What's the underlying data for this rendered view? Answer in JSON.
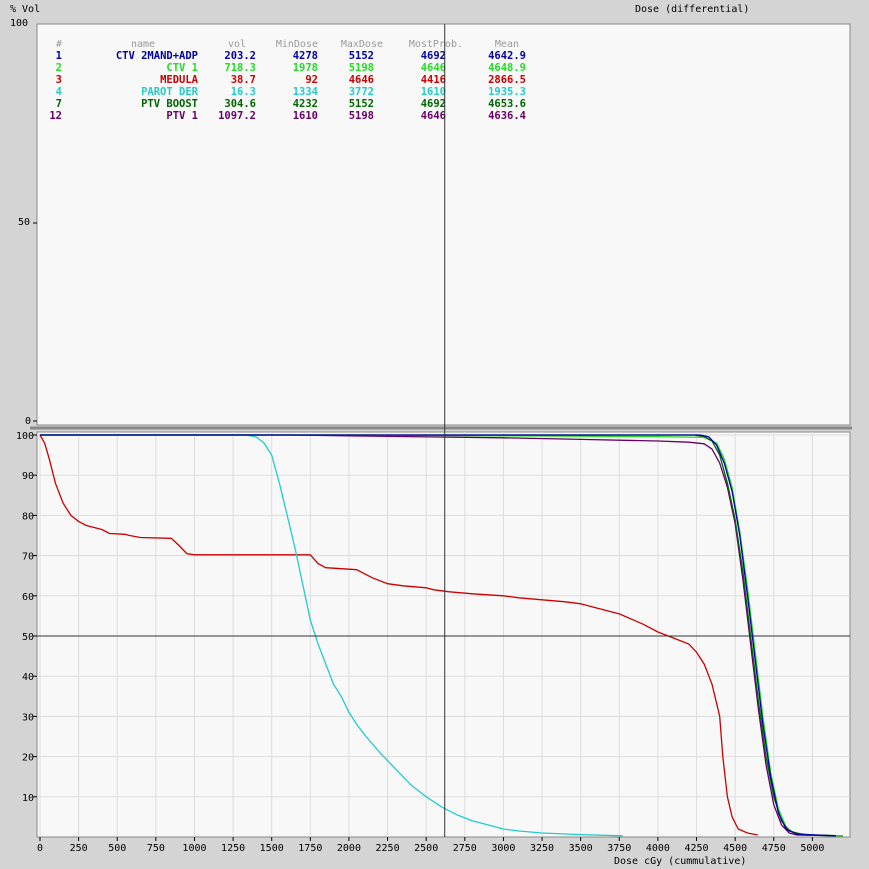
{
  "top_panel": {
    "y_label": "% Vol",
    "title": "Dose (differential)",
    "y_ticks": [
      "100",
      "50",
      "0"
    ]
  },
  "table": {
    "headers": [
      "#",
      "name",
      "vol",
      "MinDose",
      "MaxDose",
      "MostProb.",
      "Mean"
    ],
    "rows": [
      {
        "id": "1",
        "name": "CTV 2MAND+ADP",
        "vol": "203.2",
        "min": "4278",
        "max": "5152",
        "mostprob": "4692",
        "mean": "4642.9",
        "color": "#0000aa"
      },
      {
        "id": "2",
        "name": "CTV 1",
        "vol": "718.3",
        "min": "1978",
        "max": "5198",
        "mostprob": "4646",
        "mean": "4648.9",
        "color": "#22dd22"
      },
      {
        "id": "3",
        "name": "MEDULA",
        "vol": "38.7",
        "min": "92",
        "max": "4646",
        "mostprob": "4416",
        "mean": "2866.5",
        "color": "#cc0000"
      },
      {
        "id": "4",
        "name": "PAROT DER",
        "vol": "16.3",
        "min": "1334",
        "max": "3772",
        "mostprob": "1610",
        "mean": "1935.3",
        "color": "#22cccc"
      },
      {
        "id": "7",
        "name": "PTV BOOST",
        "vol": "304.6",
        "min": "4232",
        "max": "5152",
        "mostprob": "4692",
        "mean": "4653.6",
        "color": "#006600"
      },
      {
        "id": "12",
        "name": "PTV 1",
        "vol": "1097.2",
        "min": "1610",
        "max": "5198",
        "mostprob": "4646",
        "mean": "4636.4",
        "color": "#660066"
      }
    ]
  },
  "chart_data": {
    "type": "line",
    "xlabel": "Dose cGy (cummulative)",
    "ylabel": "% Vol",
    "xlim": [
      0,
      5250
    ],
    "ylim": [
      0,
      100
    ],
    "x_ticks": [
      "0",
      "250",
      "500",
      "750",
      "1000",
      "1250",
      "1500",
      "1750",
      "2000",
      "2250",
      "2500",
      "2750",
      "3000",
      "3250",
      "3500",
      "3750",
      "4000",
      "4250",
      "4500",
      "4750",
      "5000"
    ],
    "y_ticks": [
      "100",
      "90",
      "80",
      "70",
      "60",
      "50",
      "40",
      "30",
      "20",
      "10"
    ],
    "reference_line_y": 50,
    "cursor_x": 2620,
    "grid": true,
    "series": [
      {
        "name": "MEDULA",
        "color": "#cc0000",
        "points": [
          [
            0,
            100
          ],
          [
            30,
            98
          ],
          [
            60,
            94
          ],
          [
            100,
            88
          ],
          [
            150,
            83
          ],
          [
            200,
            80
          ],
          [
            250,
            78.5
          ],
          [
            300,
            77.5
          ],
          [
            350,
            77
          ],
          [
            400,
            76.5
          ],
          [
            450,
            75.5
          ],
          [
            550,
            75.3
          ],
          [
            580,
            75
          ],
          [
            650,
            74.5
          ],
          [
            850,
            74.3
          ],
          [
            900,
            72.5
          ],
          [
            950,
            70.5
          ],
          [
            1000,
            70.2
          ],
          [
            1750,
            70.2
          ],
          [
            1800,
            68
          ],
          [
            1850,
            67
          ],
          [
            2050,
            66.5
          ],
          [
            2100,
            65.5
          ],
          [
            2150,
            64.5
          ],
          [
            2250,
            63
          ],
          [
            2350,
            62.5
          ],
          [
            2500,
            62
          ],
          [
            2550,
            61.5
          ],
          [
            2650,
            61
          ],
          [
            2800,
            60.5
          ],
          [
            3000,
            60
          ],
          [
            3100,
            59.5
          ],
          [
            3250,
            59
          ],
          [
            3400,
            58.5
          ],
          [
            3500,
            58
          ],
          [
            3600,
            57
          ],
          [
            3750,
            55.5
          ],
          [
            3900,
            53
          ],
          [
            4000,
            51
          ],
          [
            4100,
            49.5
          ],
          [
            4200,
            48
          ],
          [
            4250,
            46
          ],
          [
            4300,
            43
          ],
          [
            4350,
            38
          ],
          [
            4400,
            30
          ],
          [
            4420,
            20
          ],
          [
            4450,
            10
          ],
          [
            4480,
            5
          ],
          [
            4520,
            2
          ],
          [
            4580,
            1
          ],
          [
            4646,
            0.5
          ]
        ]
      },
      {
        "name": "PAROT DER",
        "color": "#22cccc",
        "points": [
          [
            0,
            100
          ],
          [
            1334,
            100
          ],
          [
            1400,
            99.5
          ],
          [
            1450,
            98
          ],
          [
            1500,
            95
          ],
          [
            1550,
            88
          ],
          [
            1600,
            80
          ],
          [
            1650,
            72
          ],
          [
            1700,
            63
          ],
          [
            1750,
            54
          ],
          [
            1800,
            48
          ],
          [
            1850,
            43
          ],
          [
            1900,
            38
          ],
          [
            1950,
            35
          ],
          [
            2000,
            31
          ],
          [
            2050,
            28
          ],
          [
            2100,
            25.5
          ],
          [
            2200,
            21
          ],
          [
            2300,
            17
          ],
          [
            2400,
            13
          ],
          [
            2500,
            10
          ],
          [
            2600,
            7.5
          ],
          [
            2700,
            5.5
          ],
          [
            2800,
            4
          ],
          [
            2900,
            3
          ],
          [
            3000,
            2
          ],
          [
            3100,
            1.5
          ],
          [
            3250,
            1
          ],
          [
            3500,
            0.6
          ],
          [
            3772,
            0.3
          ]
        ]
      },
      {
        "name": "PTV 1",
        "color": "#660066",
        "points": [
          [
            0,
            100
          ],
          [
            1610,
            100
          ],
          [
            2000,
            99.8
          ],
          [
            3000,
            99.3
          ],
          [
            3500,
            98.9
          ],
          [
            4000,
            98.5
          ],
          [
            4200,
            98.2
          ],
          [
            4300,
            97.8
          ],
          [
            4350,
            96.5
          ],
          [
            4400,
            93
          ],
          [
            4450,
            87
          ],
          [
            4500,
            78
          ],
          [
            4550,
            64
          ],
          [
            4600,
            48
          ],
          [
            4650,
            32
          ],
          [
            4700,
            18
          ],
          [
            4750,
            8
          ],
          [
            4800,
            3
          ],
          [
            4850,
            1
          ],
          [
            4900,
            0.5
          ],
          [
            5198,
            0.3
          ]
        ]
      },
      {
        "name": "CTV 1",
        "color": "#22dd22",
        "points": [
          [
            0,
            100
          ],
          [
            1978,
            100
          ],
          [
            3000,
            99.8
          ],
          [
            3500,
            99.7
          ],
          [
            4000,
            99.6
          ],
          [
            4300,
            99.4
          ],
          [
            4380,
            98
          ],
          [
            4430,
            94
          ],
          [
            4480,
            87
          ],
          [
            4530,
            76
          ],
          [
            4580,
            62
          ],
          [
            4630,
            46
          ],
          [
            4680,
            30
          ],
          [
            4730,
            16
          ],
          [
            4780,
            7
          ],
          [
            4830,
            2.5
          ],
          [
            4880,
            1
          ],
          [
            5000,
            0.5
          ],
          [
            5198,
            0.3
          ]
        ]
      },
      {
        "name": "PTV BOOST",
        "color": "#006600",
        "points": [
          [
            0,
            100
          ],
          [
            4232,
            100
          ],
          [
            4300,
            99.6
          ],
          [
            4350,
            98.5
          ],
          [
            4400,
            95
          ],
          [
            4450,
            88
          ],
          [
            4500,
            79
          ],
          [
            4550,
            66
          ],
          [
            4600,
            50
          ],
          [
            4650,
            34
          ],
          [
            4700,
            20
          ],
          [
            4750,
            10
          ],
          [
            4800,
            4
          ],
          [
            4850,
            1.5
          ],
          [
            4950,
            0.5
          ],
          [
            5152,
            0.3
          ]
        ]
      },
      {
        "name": "CTV 2MAND+ADP",
        "color": "#0000aa",
        "points": [
          [
            0,
            100
          ],
          [
            4278,
            100
          ],
          [
            4330,
            99.5
          ],
          [
            4380,
            97.5
          ],
          [
            4430,
            93
          ],
          [
            4480,
            86
          ],
          [
            4530,
            75
          ],
          [
            4580,
            60
          ],
          [
            4630,
            44
          ],
          [
            4680,
            28
          ],
          [
            4730,
            15
          ],
          [
            4780,
            6
          ],
          [
            4830,
            2
          ],
          [
            4900,
            0.7
          ],
          [
            5152,
            0.3
          ]
        ]
      }
    ]
  }
}
